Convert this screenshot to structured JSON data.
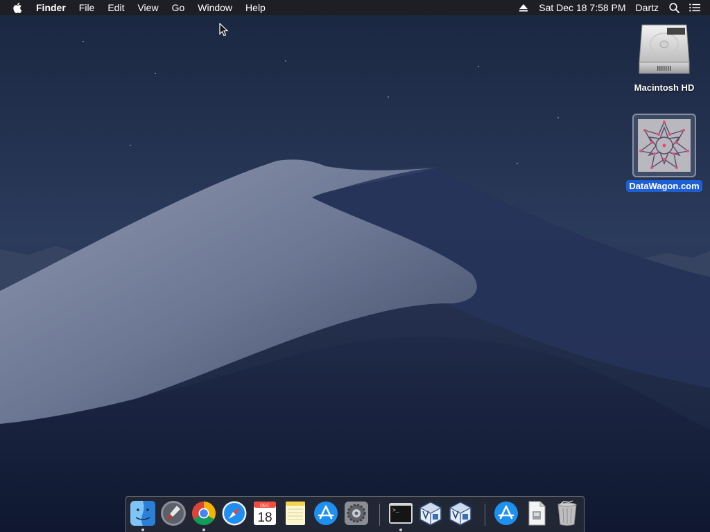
{
  "menubar": {
    "app_name": "Finder",
    "menus": [
      "File",
      "Edit",
      "View",
      "Go",
      "Window",
      "Help"
    ],
    "clock": "Sat Dec 18  7:58 PM",
    "user": "Dartz"
  },
  "desktop": {
    "icons": [
      {
        "label": "Macintosh HD",
        "icon": "hard-drive-icon",
        "selected": false
      },
      {
        "label": "DataWagon.com",
        "icon": "datawagon-icon",
        "selected": true
      }
    ]
  },
  "dock": {
    "apps": [
      {
        "name": "Finder",
        "icon": "finder-icon",
        "running": true
      },
      {
        "name": "Launchpad",
        "icon": "launchpad-icon",
        "running": false
      },
      {
        "name": "Google Chrome",
        "icon": "chrome-icon",
        "running": true
      },
      {
        "name": "Safari",
        "icon": "safari-icon",
        "running": false
      },
      {
        "name": "Calendar",
        "icon": "calendar-icon",
        "running": false,
        "month": "DEC",
        "day": "18"
      },
      {
        "name": "Notes",
        "icon": "notes-icon",
        "running": false
      },
      {
        "name": "App Store",
        "icon": "app-store-icon",
        "running": false
      },
      {
        "name": "System Preferences",
        "icon": "system-preferences-icon",
        "running": false
      },
      {
        "name": "Terminal",
        "icon": "terminal-icon",
        "running": true,
        "prompt": ">_"
      },
      {
        "name": "VirtualBox",
        "icon": "virtualbox-icon",
        "running": false
      },
      {
        "name": "VirtualBox VM",
        "icon": "virtualbox-vm-icon",
        "running": false
      },
      {
        "name": "Downloads",
        "icon": "downloads-icon",
        "running": false
      },
      {
        "name": "Document",
        "icon": "document-icon",
        "running": false
      },
      {
        "name": "Trash",
        "icon": "trash-icon",
        "running": false
      }
    ]
  },
  "colors": {
    "menubar_bg": "#1e1e22",
    "selection": "#1e5fd6",
    "sky_top": "#1c2c48",
    "sky_bottom": "#3b4c6e"
  }
}
